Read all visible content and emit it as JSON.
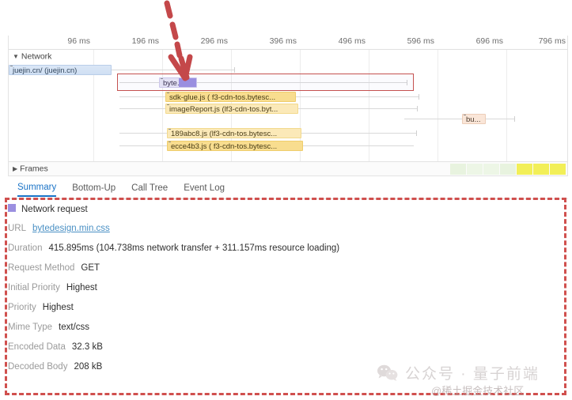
{
  "ruler": {
    "ticks": [
      "96 ms",
      "196 ms",
      "296 ms",
      "396 ms",
      "496 ms",
      "596 ms",
      "696 ms",
      "796 ms"
    ]
  },
  "timeline": {
    "network_group_label": "Network",
    "caret_open": "▼",
    "rows": [
      {
        "label": "juejin.cn/ (juejin.cn)"
      },
      {
        "label": "byte..."
      },
      {
        "label": "sdk-glue.js ( f3-cdn-tos.bytesc..."
      },
      {
        "label": "imageReport.js (lf3-cdn-tos.byt..."
      },
      {
        "label": "189abc8.js (lf3-cdn-tos.bytesc..."
      },
      {
        "label": "ecce4b3.js ( f3-cdn-tos.bytesc..."
      },
      {
        "label": "bu..."
      }
    ]
  },
  "frames": {
    "label": "Frames",
    "caret_closed": "▶",
    "dots": "···"
  },
  "tabs": [
    {
      "label": "Summary",
      "active": true
    },
    {
      "label": "Bottom-Up",
      "active": false
    },
    {
      "label": "Call Tree",
      "active": false
    },
    {
      "label": "Event Log",
      "active": false
    }
  ],
  "details": {
    "title": "Network request",
    "rows": [
      {
        "label": "URL",
        "value": "bytedesign.min.css",
        "link": true
      },
      {
        "label": "Duration",
        "value": "415.895ms (104.738ms network transfer + 311.157ms resource loading)",
        "link": false
      },
      {
        "label": "Request Method",
        "value": "GET",
        "link": false
      },
      {
        "label": "Initial Priority",
        "value": "Highest",
        "link": false
      },
      {
        "label": "Priority",
        "value": "Highest",
        "link": false
      },
      {
        "label": "Mime Type",
        "value": "text/css",
        "link": false
      },
      {
        "label": "Encoded Data",
        "value": "32.3 kB",
        "link": false
      },
      {
        "label": "Decoded Body",
        "value": "208 kB",
        "link": false
      }
    ]
  },
  "watermark": {
    "text": "公众号 · 量子前端",
    "subtext": "@稀土掘金技术社区"
  },
  "colors": {
    "accent_blue": "#1a73c7",
    "annotation_red": "#d0504e",
    "selection_purple": "#9b8fe0",
    "bar_orange": "#f8dd8f",
    "link_blue": "#4a90c4"
  }
}
